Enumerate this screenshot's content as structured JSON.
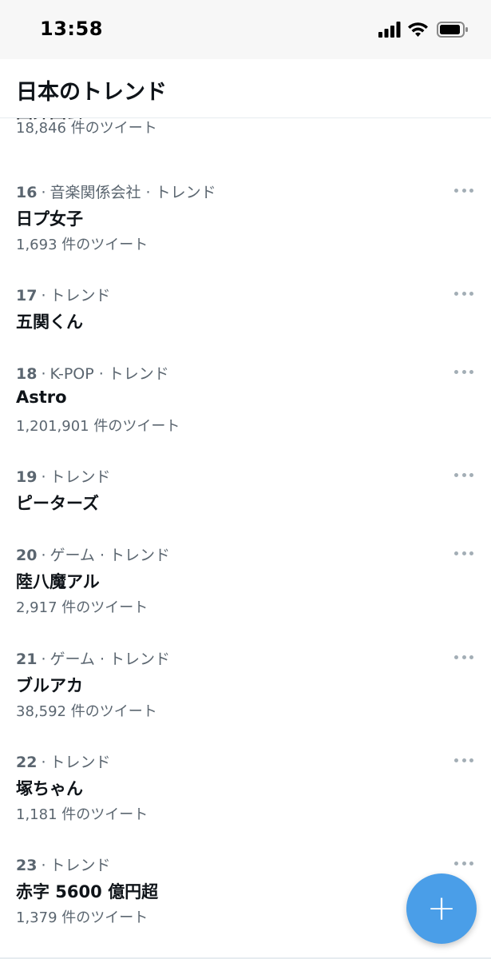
{
  "status_bar": {
    "time": "13:58",
    "icons": [
      "cellular-signal-icon",
      "wifi-icon",
      "battery-icon"
    ]
  },
  "header": {
    "title": "日本のトレンド"
  },
  "partial_trend": {
    "name": "国葬国会",
    "count": "18,846 件のツイート"
  },
  "trends": [
    {
      "rank": "16",
      "category": "音楽関係会社 · トレンド",
      "name": "日プ女子",
      "count": "1,693 件のツイート"
    },
    {
      "rank": "17",
      "category": "トレンド",
      "name": "五関くん",
      "count": ""
    },
    {
      "rank": "18",
      "category": "K-POP · トレンド",
      "name": "Astro",
      "count": "1,201,901 件のツイート"
    },
    {
      "rank": "19",
      "category": "トレンド",
      "name": "ピーターズ",
      "count": ""
    },
    {
      "rank": "20",
      "category": "ゲーム · トレンド",
      "name": "陸八魔アル",
      "count": "2,917 件のツイート"
    },
    {
      "rank": "21",
      "category": "ゲーム · トレンド",
      "name": "ブルアカ",
      "count": "38,592 件のツイート"
    },
    {
      "rank": "22",
      "category": "トレンド",
      "name": "塚ちゃん",
      "count": "1,181 件のツイート"
    },
    {
      "rank": "23",
      "category": "トレンド",
      "name": "赤字 5600 億円超",
      "count": "1,379 件のツイート"
    }
  ],
  "fab": {
    "label": "+",
    "icon": "plus-icon"
  },
  "colors": {
    "accent": "#4a9ee8",
    "text_primary": "#0f1419",
    "text_secondary": "#5b6670",
    "divider": "#e6ecf0"
  }
}
